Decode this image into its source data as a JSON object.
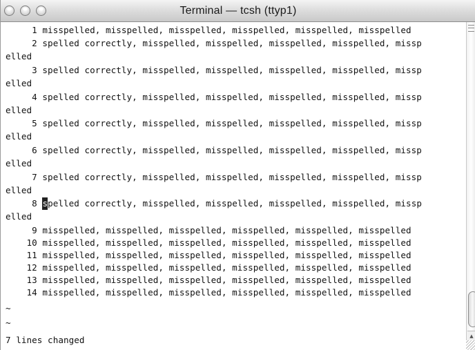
{
  "window": {
    "title": "Terminal — tcsh (ttyp1)"
  },
  "terminal": {
    "lines": [
      "     1 misspelled, misspelled, misspelled, misspelled, misspelled, misspelled",
      "     2 spelled correctly, misspelled, misspelled, misspelled, misspelled, missp",
      "elled",
      "     3 spelled correctly, misspelled, misspelled, misspelled, misspelled, missp",
      "elled",
      "     4 spelled correctly, misspelled, misspelled, misspelled, misspelled, missp",
      "elled",
      "     5 spelled correctly, misspelled, misspelled, misspelled, misspelled, missp",
      "elled",
      "     6 spelled correctly, misspelled, misspelled, misspelled, misspelled, missp",
      "elled",
      "     7 spelled correctly, misspelled, misspelled, misspelled, misspelled, missp",
      "elled",
      "     8 ",
      "elled",
      "     9 misspelled, misspelled, misspelled, misspelled, misspelled, misspelled",
      "    10 misspelled, misspelled, misspelled, misspelled, misspelled, misspelled",
      "    11 misspelled, misspelled, misspelled, misspelled, misspelled, misspelled",
      "    12 misspelled, misspelled, misspelled, misspelled, misspelled, misspelled",
      "    13 misspelled, misspelled, misspelled, misspelled, misspelled, misspelled",
      "    14 misspelled, misspelled, misspelled, misspelled, misspelled, misspelled",
      "~",
      "~",
      "7 lines changed"
    ],
    "cursor_line": {
      "cursor_char": "s",
      "after_cursor": "pelled correctly, misspelled, misspelled, misspelled, misspelled, missp"
    }
  },
  "icons": {
    "close": "close-icon",
    "minimize": "minimize-icon",
    "zoom": "zoom-icon",
    "scroll_up": "scroll-up-arrow-icon",
    "scroll_down": "scroll-down-arrow-icon"
  }
}
